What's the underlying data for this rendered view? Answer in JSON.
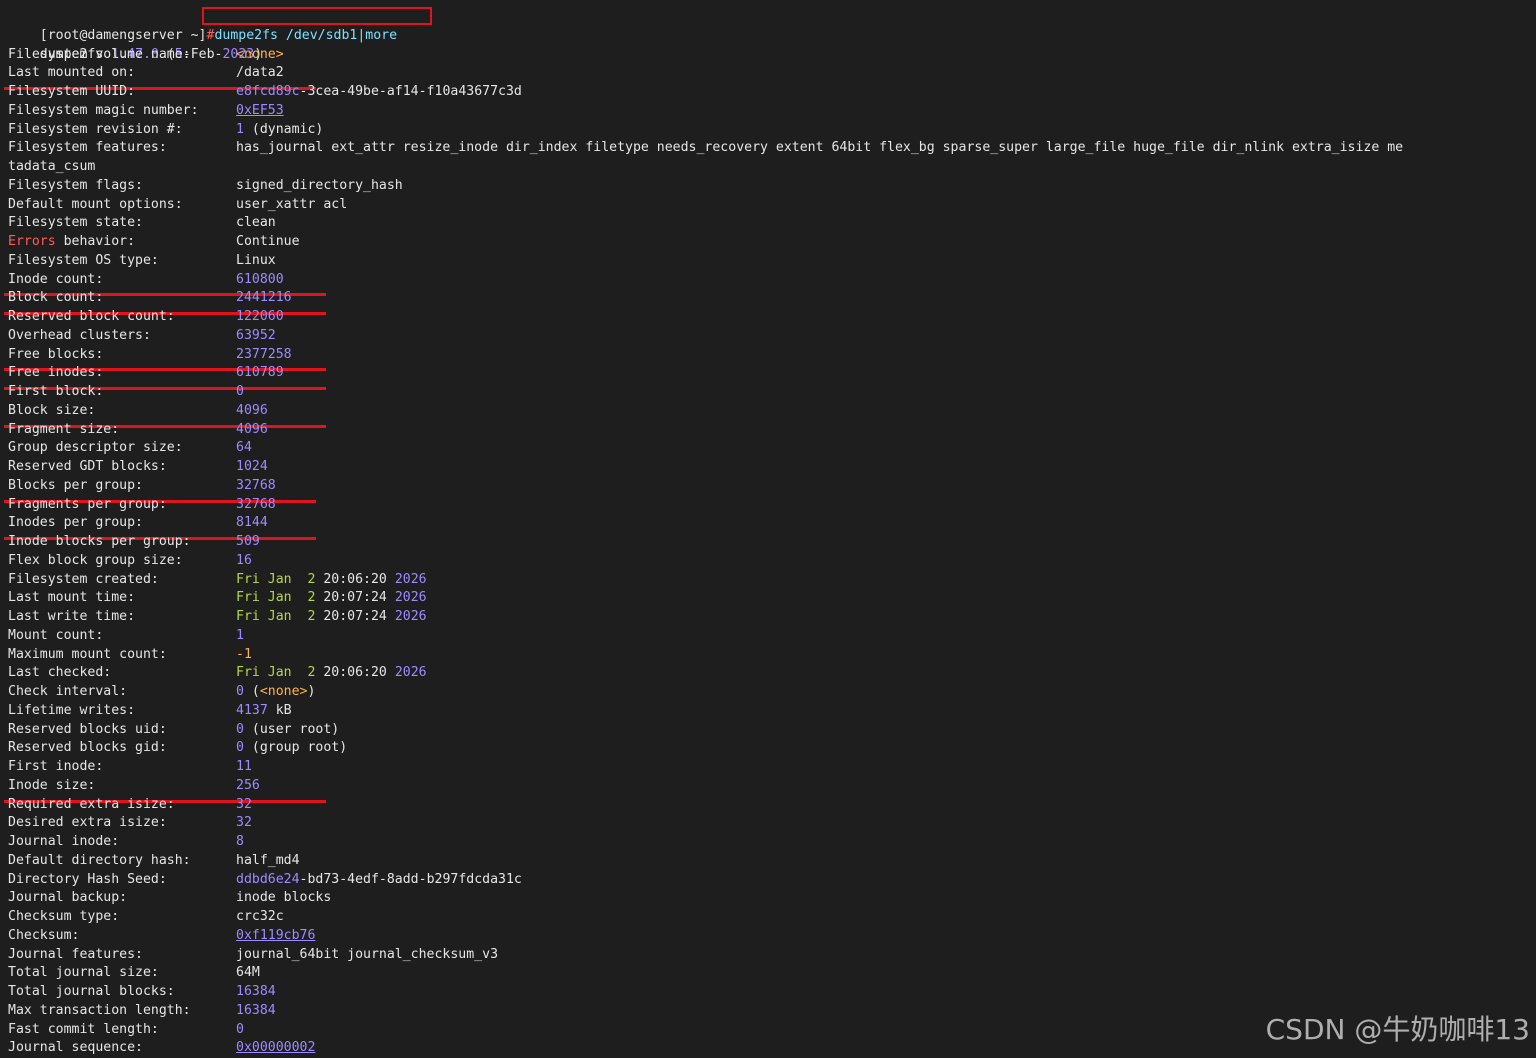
{
  "prompt": {
    "user_host": "[root@damengserver ~]",
    "symbol": "#",
    "command": "dumpe2fs /dev/sdb1|more"
  },
  "version_line": {
    "name": "dumpe2fs",
    "version": "1.47.0",
    "open": "(",
    "date_day": "5",
    "date_rest": "-Feb-",
    "date_year": "2023",
    "close": ")"
  },
  "fields": [
    {
      "label": "Filesystem volume name",
      "value": "<none>",
      "color": "orange",
      "highlight": false
    },
    {
      "label": "Last mounted on",
      "value": "/data2",
      "color": "white",
      "highlight": true
    },
    {
      "label": "Filesystem UUID",
      "value_parts": [
        {
          "t": "e8fcd89c",
          "c": "num"
        },
        {
          "t": "-3cea-49be-af14-f10a43677c3d",
          "c": "white"
        }
      ],
      "highlight": false
    },
    {
      "label": "Filesystem magic number",
      "value": "0xEF53",
      "color": "num",
      "underline": true,
      "highlight": false
    },
    {
      "label": "Filesystem revision #",
      "value_parts": [
        {
          "t": "1",
          "c": "num"
        },
        {
          "t": " (dynamic)",
          "c": "white"
        }
      ],
      "highlight": false
    },
    {
      "label": "Filesystem features",
      "value": "has_journal ext_attr resize_inode dir_index filetype needs_recovery extent 64bit flex_bg sparse_super large_file huge_file dir_nlink extra_isize me",
      "color": "white",
      "highlight": false
    },
    {
      "wrap": "tadata_csum"
    },
    {
      "label": "Filesystem flags",
      "value": "signed_directory_hash",
      "color": "white",
      "highlight": false
    },
    {
      "label": "Default mount options",
      "value": "user_xattr acl",
      "color": "white",
      "highlight": false
    },
    {
      "label": "Filesystem state",
      "value": "clean",
      "color": "white",
      "highlight": false
    },
    {
      "label_parts": [
        {
          "t": "Errors",
          "c": "red"
        },
        {
          "t": " behavior",
          "c": "white"
        }
      ],
      "value": "Continue",
      "color": "white",
      "highlight": false
    },
    {
      "label": "Filesystem OS type",
      "value": "Linux",
      "color": "white",
      "highlight": false
    },
    {
      "label": "Inode count",
      "value": "610800",
      "color": "num",
      "highlight": true
    },
    {
      "label": "Block count",
      "value": "2441216",
      "color": "num",
      "highlight": true
    },
    {
      "label": "Reserved block count",
      "value": "122060",
      "color": "num",
      "highlight": false
    },
    {
      "label": "Overhead clusters",
      "value": "63952",
      "color": "num",
      "highlight": false
    },
    {
      "label": "Free blocks",
      "value": "2377258",
      "color": "num",
      "highlight": true
    },
    {
      "label": "Free inodes",
      "value": "610789",
      "color": "num",
      "highlight": true
    },
    {
      "label": "First block",
      "value": "0",
      "color": "num",
      "highlight": false
    },
    {
      "label": "Block size",
      "value": "4096",
      "color": "num",
      "highlight": true
    },
    {
      "label": "Fragment size",
      "value": "4096",
      "color": "num",
      "highlight": false
    },
    {
      "label": "Group descriptor size",
      "value": "64",
      "color": "num",
      "highlight": false
    },
    {
      "label": "Reserved GDT blocks",
      "value": "1024",
      "color": "num",
      "highlight": false
    },
    {
      "label": "Blocks per group",
      "value": "32768",
      "color": "num",
      "highlight": true
    },
    {
      "label": "Fragments per group",
      "value": "32768",
      "color": "num",
      "highlight": false
    },
    {
      "label": "Inodes per group",
      "value": "8144",
      "color": "num",
      "highlight": true
    },
    {
      "label": "Inode blocks per group",
      "value": "509",
      "color": "num",
      "highlight": false
    },
    {
      "label": "Flex block group size",
      "value": "16",
      "color": "num",
      "highlight": false
    },
    {
      "label": "Filesystem created",
      "value_parts": [
        {
          "t": "Fri Jan  2 ",
          "c": "green"
        },
        {
          "t": "20:06:20",
          "c": "white"
        },
        {
          "t": " 2026",
          "c": "num"
        }
      ],
      "highlight": false
    },
    {
      "label": "Last mount time",
      "value_parts": [
        {
          "t": "Fri Jan  2 ",
          "c": "green"
        },
        {
          "t": "20:07:24",
          "c": "white"
        },
        {
          "t": " 2026",
          "c": "num"
        }
      ],
      "highlight": false
    },
    {
      "label": "Last write time",
      "value_parts": [
        {
          "t": "Fri Jan  2 ",
          "c": "green"
        },
        {
          "t": "20:07:24",
          "c": "white"
        },
        {
          "t": " 2026",
          "c": "num"
        }
      ],
      "highlight": false
    },
    {
      "label": "Mount count",
      "value": "1",
      "color": "num",
      "highlight": false
    },
    {
      "label": "Maximum mount count",
      "value": "-1",
      "color": "orange",
      "highlight": false
    },
    {
      "label": "Last checked",
      "value_parts": [
        {
          "t": "Fri Jan  2 ",
          "c": "green"
        },
        {
          "t": "20:06:20",
          "c": "white"
        },
        {
          "t": " 2026",
          "c": "num"
        }
      ],
      "highlight": false
    },
    {
      "label": "Check interval",
      "value_parts": [
        {
          "t": "0",
          "c": "num"
        },
        {
          "t": " (",
          "c": "white"
        },
        {
          "t": "<none>",
          "c": "orange"
        },
        {
          "t": ")",
          "c": "white"
        }
      ],
      "highlight": false
    },
    {
      "label": "Lifetime writes",
      "value_parts": [
        {
          "t": "4137",
          "c": "num"
        },
        {
          "t": " kB",
          "c": "white"
        }
      ],
      "highlight": false
    },
    {
      "label": "Reserved blocks uid",
      "value_parts": [
        {
          "t": "0",
          "c": "num"
        },
        {
          "t": " (user root)",
          "c": "white"
        }
      ],
      "highlight": false
    },
    {
      "label": "Reserved blocks gid",
      "value_parts": [
        {
          "t": "0",
          "c": "num"
        },
        {
          "t": " (group root)",
          "c": "white"
        }
      ],
      "highlight": false
    },
    {
      "label": "First inode",
      "value": "11",
      "color": "num",
      "highlight": false
    },
    {
      "label": "Inode size",
      "value": "256",
      "color": "num",
      "highlight": true
    },
    {
      "label": "Required extra isize",
      "value": "32",
      "color": "num",
      "highlight": false
    },
    {
      "label": "Desired extra isize",
      "value": "32",
      "color": "num",
      "highlight": false
    },
    {
      "label": "Journal inode",
      "value": "8",
      "color": "num",
      "highlight": false
    },
    {
      "label": "Default directory hash",
      "value": "half_md4",
      "color": "white",
      "highlight": false
    },
    {
      "label": "Directory Hash Seed",
      "value_parts": [
        {
          "t": "ddbd6e24",
          "c": "num"
        },
        {
          "t": "-bd73-4edf-8add-b297fdcda31c",
          "c": "white"
        }
      ],
      "highlight": false
    },
    {
      "label": "Journal backup",
      "value": "inode blocks",
      "color": "white",
      "highlight": false
    },
    {
      "label": "Checksum type",
      "value": "crc32c",
      "color": "white",
      "highlight": false
    },
    {
      "label": "Checksum",
      "value": "0xf119cb76",
      "color": "num",
      "underline": true,
      "highlight": false
    },
    {
      "label": "Journal features",
      "value": "journal_64bit journal_checksum_v3",
      "color": "white",
      "highlight": false
    },
    {
      "label": "Total journal size",
      "value": "64M",
      "color": "white",
      "highlight": false
    },
    {
      "label": "Total journal blocks",
      "value": "16384",
      "color": "num",
      "highlight": false
    },
    {
      "label": "Max transaction length",
      "value": "16384",
      "color": "num",
      "highlight": false
    },
    {
      "label": "Fast commit length",
      "value": "0",
      "color": "num",
      "highlight": false
    },
    {
      "label": "Journal sequence",
      "value": "0x00000002",
      "color": "num",
      "underline": true,
      "highlight": false
    }
  ],
  "watermark": "CSDN @牛奶咖啡13",
  "colors": {
    "background": "#1e1e1e",
    "text": "#e6e6e6",
    "number": "#9d8cff",
    "date": "#b5d64a",
    "error": "#ff5c5c",
    "none": "#ffb347",
    "annotation": "#e0141c"
  }
}
